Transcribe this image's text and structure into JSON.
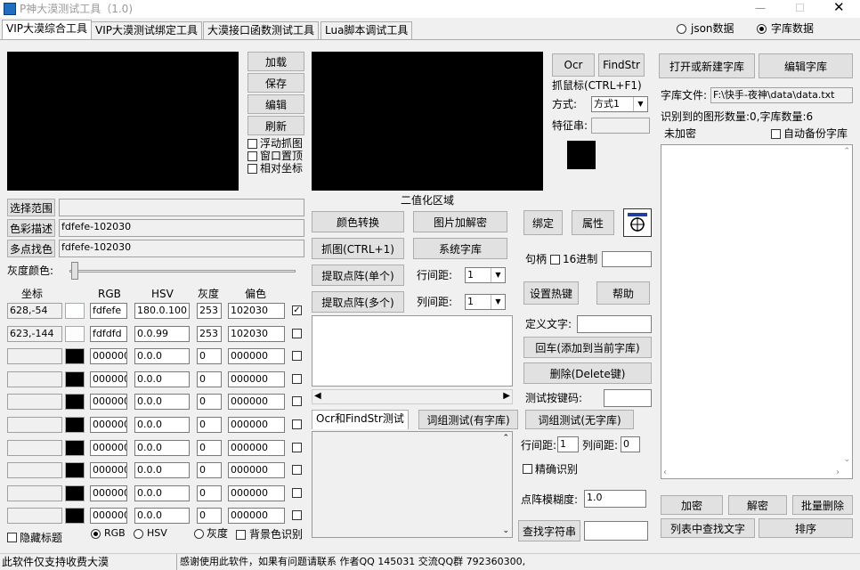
{
  "window": {
    "title": "P神大漠测试工具（1.0)"
  },
  "tabs": [
    "VIP大漠综合工具",
    "VIP大漠测试绑定工具",
    "大漠接口函数测试工具",
    "Lua脚本调试工具"
  ],
  "data_mode": {
    "options": [
      "json数据",
      "字库数据"
    ],
    "selected": "字库数据"
  },
  "left_buttons": {
    "load": "加载",
    "save": "保存",
    "edit": "编辑",
    "refresh": "刷新"
  },
  "capture_options": {
    "float": "浮动抓图",
    "top": "窗口置顶",
    "relative": "相对坐标"
  },
  "range": {
    "select_label": "选择范围",
    "select_value": "",
    "color_desc_label": "色彩描述",
    "color_desc_value": "fdfefe-102030",
    "multi_label": "多点找色",
    "multi_value": "fdfefe-102030",
    "gray_label": "灰度颜色:"
  },
  "binarize_label": "二值化区域",
  "mid_buttons": {
    "color_convert": "颜色转换",
    "img_decrypt": "图片加解密",
    "capture": "抓图(CTRL+1)",
    "system_lib": "系统字库",
    "extract_single": "提取点阵(单个)",
    "extract_multi": "提取点阵(多个)",
    "row_gap_label": "行间距:",
    "row_gap_value": "1",
    "col_gap_label": "列间距:",
    "col_gap_value": "1"
  },
  "right_top": {
    "ocr": "Ocr",
    "findstr": "FindStr",
    "grab_mouse": "抓鼠标(CTRL+F1)",
    "mode_label": "方式:",
    "mode_value": "方式1",
    "feature_label": "特征串:"
  },
  "bind": {
    "bind": "绑定",
    "prop": "属性",
    "handle_label": "句柄",
    "hex_label": "16进制",
    "hotkey": "设置热键",
    "help": "帮助"
  },
  "define": {
    "label": "定义文字:",
    "enter": "回车(添加到当前字库)",
    "delete": "删除(Delete键)",
    "test_key_label": "测试按键码:"
  },
  "bottom_tabs": {
    "ocr_findstr": "Ocr和FindStr测试",
    "word_test_lib": "词组测试(有字库)",
    "word_test_nolib": "词组测试(无字库)"
  },
  "ocr_opts": {
    "row_label": "行间距:",
    "row_value": "1",
    "col_label": "列间距:",
    "col_value": "0",
    "precise": "精确识别",
    "fuzzy_label": "点阵模糊度:",
    "fuzzy_value": "1.0",
    "find_btn": "查找字符串"
  },
  "library": {
    "open": "打开或新建字库",
    "edit": "编辑字库",
    "file_label": "字库文件:",
    "file_value": "F:\\快手-夜神\\data\\data.txt",
    "count_text": "识别到的图形数量:0,字库数量:6",
    "encrypt_status": "未加密",
    "auto_backup": "自动备份字库",
    "encrypt": "加密",
    "decrypt": "解密",
    "batch_delete": "批量删除",
    "find_text": "列表中查找文字",
    "sort": "排序"
  },
  "grid": {
    "headers": [
      "坐标",
      "RGB",
      "HSV",
      "灰度",
      "偏色"
    ],
    "rows": [
      {
        "coord": "628,-54",
        "rgb": "fdfefe",
        "hsv": "180.0.100",
        "gray": "253",
        "offset": "102030",
        "checked": true,
        "swatch": "#fdfefe"
      },
      {
        "coord": "623,-144",
        "rgb": "fdfdfd",
        "hsv": "0.0.99",
        "gray": "253",
        "offset": "102030",
        "checked": false,
        "swatch": "#fdfdfd"
      },
      {
        "coord": "",
        "rgb": "000000",
        "hsv": "0.0.0",
        "gray": "0",
        "offset": "000000",
        "checked": false,
        "swatch": "#000000"
      },
      {
        "coord": "",
        "rgb": "000000",
        "hsv": "0.0.0",
        "gray": "0",
        "offset": "000000",
        "checked": false,
        "swatch": "#000000"
      },
      {
        "coord": "",
        "rgb": "000000",
        "hsv": "0.0.0",
        "gray": "0",
        "offset": "000000",
        "checked": false,
        "swatch": "#000000"
      },
      {
        "coord": "",
        "rgb": "000000",
        "hsv": "0.0.0",
        "gray": "0",
        "offset": "000000",
        "checked": false,
        "swatch": "#000000"
      },
      {
        "coord": "",
        "rgb": "000000",
        "hsv": "0.0.0",
        "gray": "0",
        "offset": "000000",
        "checked": false,
        "swatch": "#000000"
      },
      {
        "coord": "",
        "rgb": "000000",
        "hsv": "0.0.0",
        "gray": "0",
        "offset": "000000",
        "checked": false,
        "swatch": "#000000"
      },
      {
        "coord": "",
        "rgb": "000000",
        "hsv": "0.0.0",
        "gray": "0",
        "offset": "000000",
        "checked": false,
        "swatch": "#000000"
      },
      {
        "coord": "",
        "rgb": "000000",
        "hsv": "0.0.0",
        "gray": "0",
        "offset": "000000",
        "checked": false,
        "swatch": "#000000"
      }
    ]
  },
  "grid_footer": {
    "hide_title": "隐藏标题",
    "rgb": "RGB",
    "hsv": "HSV",
    "gray": "灰度",
    "bg_recog": "背景色识别"
  },
  "status": {
    "left": "此软件仅支持收费大漠",
    "right": "感谢使用此软件，如果有问题请联系  作者QQ 145031   交流QQ群 792360300,"
  }
}
